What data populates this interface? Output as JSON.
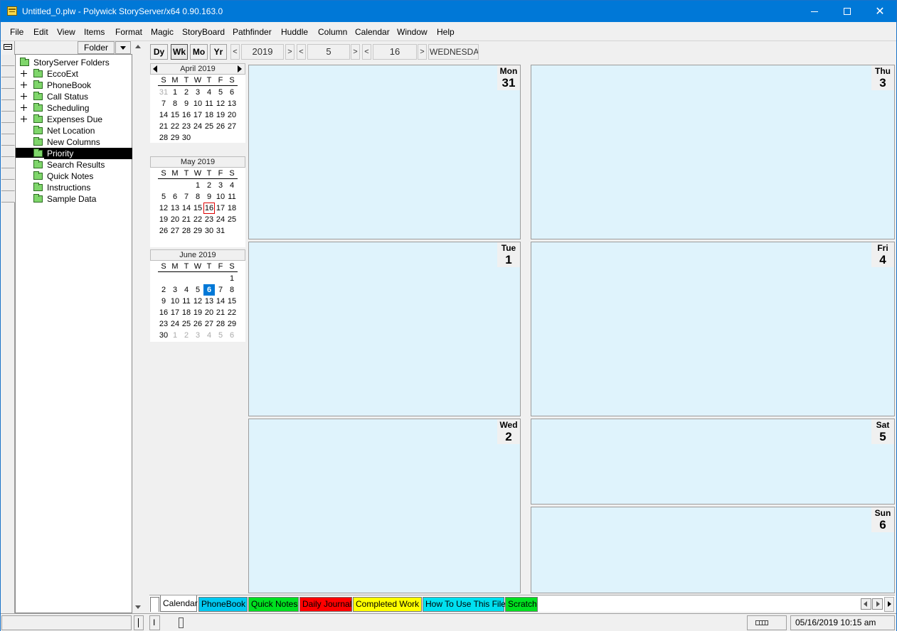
{
  "window": {
    "title": "Untitled_0.plw - Polywick StoryServer/x64 0.90.163.0"
  },
  "menu": [
    "File",
    "Edit",
    "View",
    "Items",
    "Format",
    "Magic",
    "StoryBoard",
    "Pathfinder",
    "Huddle",
    "Column",
    "Calendar",
    "Window",
    "Help"
  ],
  "folder_pane": {
    "header_label": "Folder",
    "root": "StoryServer Folders",
    "items": [
      {
        "label": "EccoExt",
        "expandable": true
      },
      {
        "label": "PhoneBook",
        "expandable": true
      },
      {
        "label": "Call Status",
        "expandable": true
      },
      {
        "label": "Scheduling",
        "expandable": true
      },
      {
        "label": "Expenses Due",
        "expandable": true
      },
      {
        "label": "Net Location",
        "expandable": false
      },
      {
        "label": "New Columns",
        "expandable": false
      },
      {
        "label": "Priority",
        "expandable": false,
        "selected": true
      },
      {
        "label": "Search Results",
        "expandable": false
      },
      {
        "label": "Quick Notes",
        "expandable": false
      },
      {
        "label": "Instructions",
        "expandable": false
      },
      {
        "label": "Sample Data",
        "expandable": false
      }
    ]
  },
  "calendar_toolbar": {
    "view_buttons": [
      "Dy",
      "Wk",
      "Mo",
      "Yr"
    ],
    "active_view": "Wk",
    "year": "2019",
    "month": "5",
    "day": "16",
    "weekday": "WEDNESDAY",
    "prev_symbol": "<",
    "next_symbol": ">"
  },
  "mini_calendars": [
    {
      "title": "April 2019",
      "dow": [
        "S",
        "M",
        "T",
        "W",
        "T",
        "F",
        "S"
      ],
      "weeks": [
        [
          {
            "d": "31",
            "dim": true
          },
          {
            "d": "1"
          },
          {
            "d": "2"
          },
          {
            "d": "3"
          },
          {
            "d": "4"
          },
          {
            "d": "5"
          },
          {
            "d": "6"
          }
        ],
        [
          {
            "d": "7"
          },
          {
            "d": "8"
          },
          {
            "d": "9"
          },
          {
            "d": "10"
          },
          {
            "d": "11"
          },
          {
            "d": "12"
          },
          {
            "d": "13"
          }
        ],
        [
          {
            "d": "14"
          },
          {
            "d": "15"
          },
          {
            "d": "16"
          },
          {
            "d": "17"
          },
          {
            "d": "18"
          },
          {
            "d": "19"
          },
          {
            "d": "20"
          }
        ],
        [
          {
            "d": "21"
          },
          {
            "d": "22"
          },
          {
            "d": "23"
          },
          {
            "d": "24"
          },
          {
            "d": "25"
          },
          {
            "d": "26"
          },
          {
            "d": "27"
          }
        ],
        [
          {
            "d": "28"
          },
          {
            "d": "29"
          },
          {
            "d": "30"
          }
        ]
      ],
      "nav": true
    },
    {
      "title": "May 2019",
      "dow": [
        "S",
        "M",
        "T",
        "W",
        "T",
        "F",
        "S"
      ],
      "weeks": [
        [
          {
            "d": ""
          },
          {
            "d": ""
          },
          {
            "d": ""
          },
          {
            "d": "1"
          },
          {
            "d": "2"
          },
          {
            "d": "3"
          },
          {
            "d": "4"
          }
        ],
        [
          {
            "d": "5"
          },
          {
            "d": "6"
          },
          {
            "d": "7"
          },
          {
            "d": "8"
          },
          {
            "d": "9"
          },
          {
            "d": "10"
          },
          {
            "d": "11"
          }
        ],
        [
          {
            "d": "12"
          },
          {
            "d": "13"
          },
          {
            "d": "14"
          },
          {
            "d": "15"
          },
          {
            "d": "16",
            "today": true
          },
          {
            "d": "17"
          },
          {
            "d": "18"
          }
        ],
        [
          {
            "d": "19"
          },
          {
            "d": "20"
          },
          {
            "d": "21"
          },
          {
            "d": "22"
          },
          {
            "d": "23"
          },
          {
            "d": "24"
          },
          {
            "d": "25"
          }
        ],
        [
          {
            "d": "26"
          },
          {
            "d": "27"
          },
          {
            "d": "28"
          },
          {
            "d": "29"
          },
          {
            "d": "30"
          },
          {
            "d": "31"
          }
        ]
      ],
      "nav": false
    },
    {
      "title": "June 2019",
      "dow": [
        "S",
        "M",
        "T",
        "W",
        "T",
        "F",
        "S"
      ],
      "weeks": [
        [
          {
            "d": ""
          },
          {
            "d": ""
          },
          {
            "d": ""
          },
          {
            "d": ""
          },
          {
            "d": ""
          },
          {
            "d": ""
          },
          {
            "d": "1"
          }
        ],
        [
          {
            "d": "2"
          },
          {
            "d": "3"
          },
          {
            "d": "4"
          },
          {
            "d": "5"
          },
          {
            "d": "6",
            "selected": true
          },
          {
            "d": "7"
          },
          {
            "d": "8"
          }
        ],
        [
          {
            "d": "9"
          },
          {
            "d": "10"
          },
          {
            "d": "11"
          },
          {
            "d": "12"
          },
          {
            "d": "13"
          },
          {
            "d": "14"
          },
          {
            "d": "15"
          }
        ],
        [
          {
            "d": "16"
          },
          {
            "d": "17"
          },
          {
            "d": "18"
          },
          {
            "d": "19"
          },
          {
            "d": "20"
          },
          {
            "d": "21"
          },
          {
            "d": "22"
          }
        ],
        [
          {
            "d": "23"
          },
          {
            "d": "24"
          },
          {
            "d": "25"
          },
          {
            "d": "26"
          },
          {
            "d": "27"
          },
          {
            "d": "28"
          },
          {
            "d": "29"
          }
        ],
        [
          {
            "d": "30"
          },
          {
            "d": "1",
            "dim": true
          },
          {
            "d": "2",
            "dim": true
          },
          {
            "d": "3",
            "dim": true
          },
          {
            "d": "4",
            "dim": true
          },
          {
            "d": "5",
            "dim": true
          },
          {
            "d": "6",
            "dim": true
          }
        ]
      ],
      "nav": false
    }
  ],
  "week_days": [
    {
      "name": "Mon",
      "num": "31"
    },
    {
      "name": "Tue",
      "num": "1"
    },
    {
      "name": "Wed",
      "num": "2"
    },
    {
      "name": "Thu",
      "num": "3"
    },
    {
      "name": "Fri",
      "num": "4"
    },
    {
      "name": "Sat",
      "num": "5"
    },
    {
      "name": "Sun",
      "num": "6"
    }
  ],
  "tabs": [
    {
      "label": "Calendar",
      "color": "#ffffff",
      "text_color": "#000000",
      "active": true
    },
    {
      "label": "PhoneBook",
      "color": "#00c8f0",
      "text_color": "#000000"
    },
    {
      "label": "Quick Notes",
      "color": "#00e020",
      "text_color": "#000000"
    },
    {
      "label": "Daily Journal",
      "color": "#ff0000",
      "text_color": "#000000"
    },
    {
      "label": "Completed Work",
      "color": "#ffff00",
      "text_color": "#000000"
    },
    {
      "label": "How To Use This File",
      "color": "#00e0f0",
      "text_color": "#000000"
    },
    {
      "label": "Scratch",
      "color": "#00e020",
      "text_color": "#000000"
    }
  ],
  "status_bar": {
    "left_marker": "I",
    "clock": "05/16/2019 10:15 am"
  },
  "colors": {
    "title_bar": "#0078d7",
    "day_panel": "#dff3fc",
    "today_border": "#dd0000",
    "selected_day": "#0078d7"
  }
}
